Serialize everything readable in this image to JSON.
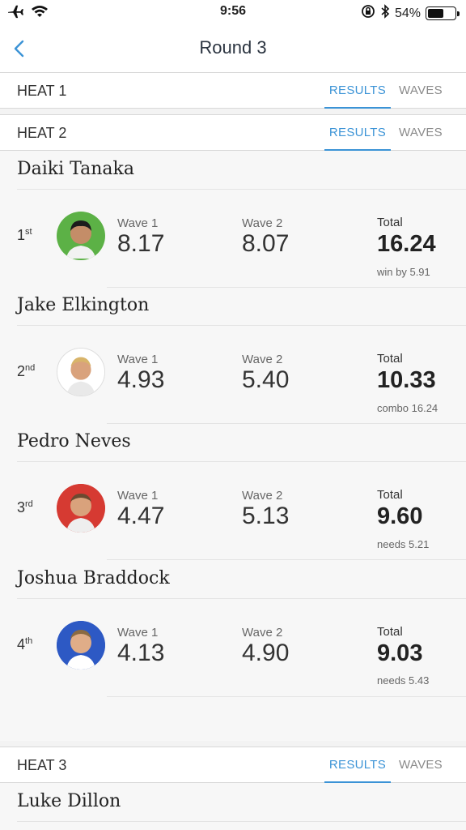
{
  "status": {
    "time": "9:56",
    "battery": "54%",
    "battery_level": 0.54
  },
  "nav": {
    "title": "Round 3"
  },
  "tabs": {
    "results": "RESULTS",
    "waves": "WAVES"
  },
  "heats": [
    {
      "label": "HEAT 1"
    },
    {
      "label": "HEAT 2"
    },
    {
      "label": "HEAT 3"
    }
  ],
  "surfers": [
    {
      "name": "Daiki Tanaka",
      "rank_num": "1",
      "rank_suffix": "st",
      "wave1_label": "Wave 1",
      "wave1": "8.17",
      "wave2_label": "Wave 2",
      "wave2": "8.07",
      "total_label": "Total",
      "total": "16.24",
      "note": "win by 5.91",
      "color": "#5cb146"
    },
    {
      "name": "Jake Elkington",
      "rank_num": "2",
      "rank_suffix": "nd",
      "wave1_label": "Wave 1",
      "wave1": "4.93",
      "wave2_label": "Wave 2",
      "wave2": "5.40",
      "total_label": "Total",
      "total": "10.33",
      "note": "combo 16.24",
      "color": "#ffffff"
    },
    {
      "name": "Pedro Neves",
      "rank_num": "3",
      "rank_suffix": "rd",
      "wave1_label": "Wave 1",
      "wave1": "4.47",
      "wave2_label": "Wave 2",
      "wave2": "5.13",
      "total_label": "Total",
      "total": "9.60",
      "note": "needs 5.21",
      "color": "#d63a32"
    },
    {
      "name": "Joshua Braddock",
      "rank_num": "4",
      "rank_suffix": "th",
      "wave1_label": "Wave 1",
      "wave1": "4.13",
      "wave2_label": "Wave 2",
      "wave2": "4.90",
      "total_label": "Total",
      "total": "9.03",
      "note": "needs 5.43",
      "color": "#2d59c4"
    },
    {
      "name": "Luke Dillon"
    }
  ]
}
